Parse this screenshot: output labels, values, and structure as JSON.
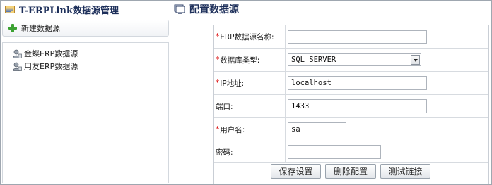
{
  "left_panel": {
    "title": "T-ERPLink数据源管理",
    "new_button_label": "新建数据源",
    "tree": [
      {
        "label": "金蝶ERP数据源"
      },
      {
        "label": "用友ERP数据源"
      }
    ]
  },
  "right_panel": {
    "title": "配置数据源",
    "fields": {
      "name": {
        "label": "ERP数据源名称:",
        "required": true,
        "value": ""
      },
      "dbtype": {
        "label": "数据库类型:",
        "required": true,
        "value": "SQL SERVER"
      },
      "ip": {
        "label": "IP地址:",
        "required": true,
        "value": "localhost"
      },
      "port": {
        "label": "端口:",
        "required": false,
        "value": "1433"
      },
      "user": {
        "label": "用户名:",
        "required": true,
        "value": "sa"
      },
      "password": {
        "label": "密码:",
        "required": false,
        "value": ""
      }
    },
    "required_mark": "*",
    "buttons": {
      "save": "保存设置",
      "delete": "删除配置",
      "test": "测试链接"
    }
  },
  "colors": {
    "title": "#1d2f5a",
    "required": "#dd1111",
    "plus_icon": "#3ca232"
  }
}
